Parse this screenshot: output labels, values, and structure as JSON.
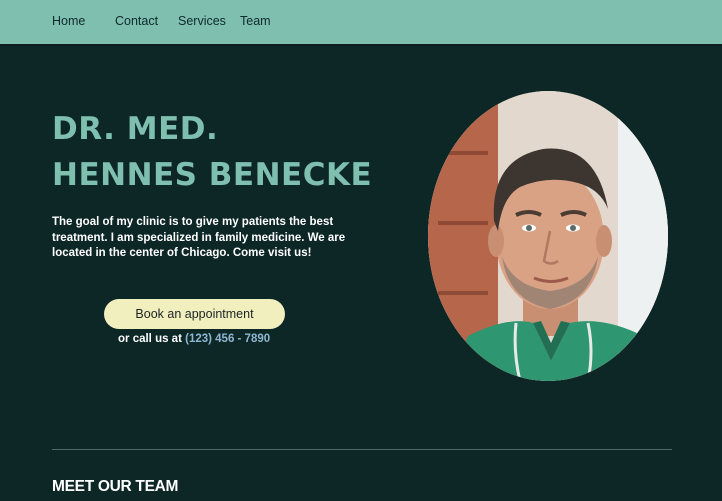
{
  "nav": {
    "items": [
      {
        "label": "Home"
      },
      {
        "label": "Contact"
      },
      {
        "label": "Services"
      },
      {
        "label": "Team"
      }
    ]
  },
  "hero": {
    "title_line1": "DR. MED.",
    "title_line2": "HENNES BENECKE",
    "description": "The goal of my clinic is to give my patients the best treatment.  I am specialized in family medicine. We are located in the center of Chicago. Come visit us!",
    "cta_label": "Book an appointment",
    "call_prefix": "or call us at ",
    "phone": "(123) 456 - 7890",
    "portrait_icon": "doctor-portrait"
  },
  "team": {
    "heading": "MEET OUR TEAM"
  },
  "colors": {
    "background": "#0d2626",
    "nav_background": "#7ebfb0",
    "accent": "#7ebfb0",
    "button": "#f2efbf",
    "phone_link": "#8fb7cf"
  }
}
